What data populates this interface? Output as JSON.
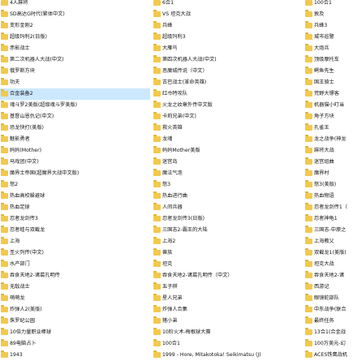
{
  "accent_color": "#f2c94c",
  "selected_color": "#cce8ff",
  "columns": [
    {
      "items": [
        {
          "label": "4人麻将"
        },
        {
          "label": "SD高达G时代(繁体中文)"
        },
        {
          "label": "变形金刚2"
        },
        {
          "label": "超级玛利2(日版)"
        },
        {
          "label": "赤影战士"
        },
        {
          "label": "第二次机器人大战(中文)"
        },
        {
          "label": "俄罗斯方块"
        },
        {
          "label": "功夫"
        },
        {
          "label": "合金装备2",
          "selected": true
        },
        {
          "label": "魂斗罗2美版(超级魂斗罗美版)"
        },
        {
          "label": "基督山恩仇记(中文)"
        },
        {
          "label": "恐龙快打(美版)"
        },
        {
          "label": "魅影勇者"
        },
        {
          "label": "妈妈(Mother)"
        },
        {
          "label": "马戏团(中文)"
        },
        {
          "label": "魔界士帝国(超魔界大战中文版)"
        },
        {
          "label": "怒2"
        },
        {
          "label": "热血高校躲避球"
        },
        {
          "label": "热血足球"
        },
        {
          "label": "忍者龙剑传3"
        },
        {
          "label": "忍者蛙与双截龙"
        },
        {
          "label": "上海"
        },
        {
          "label": "圣火列传(中文)"
        },
        {
          "label": "水产部门"
        },
        {
          "label": "吞食天地2-诸葛孔明传"
        },
        {
          "label": "无敌战士"
        },
        {
          "label": "萌萌龙"
        },
        {
          "label": "炸弹人2(美版)"
        },
        {
          "label": "侏罗纪公园"
        },
        {
          "label": "10倍力量职业棒球"
        },
        {
          "label": "89电脑占卜"
        },
        {
          "label": "1943"
        }
      ]
    },
    {
      "items": [
        {
          "label": "6合1"
        },
        {
          "label": "VS 坦克大战"
        },
        {
          "label": "兵蜂"
        },
        {
          "label": "超级玛利3"
        },
        {
          "label": "大雁鸟"
        },
        {
          "label": "第四次机器人大战(中文)"
        },
        {
          "label": "恶魔城传说（中文）"
        },
        {
          "label": "古巴战士(革命英雄)"
        },
        {
          "label": "红巾特攻队"
        },
        {
          "label": "火龙之纹章外传中文版"
        },
        {
          "label": "卡莉兄弟(中文)"
        },
        {
          "label": "救火英雄"
        },
        {
          "label": "龙魂"
        },
        {
          "label": "妈妈Mother美版"
        },
        {
          "label": "迷宫岛"
        },
        {
          "label": "魔法气泡"
        },
        {
          "label": "怒3"
        },
        {
          "label": "热血进行曲"
        },
        {
          "label": "人间兵器"
        },
        {
          "label": "忍者龙剑传3(日版)"
        },
        {
          "label": "三国志2-霸王的大陆"
        },
        {
          "label": "上海2"
        },
        {
          "label": "兽族"
        },
        {
          "label": "坦克"
        },
        {
          "label": "吞食天地2-诸葛孔明传（中文）"
        },
        {
          "label": "五子棋"
        },
        {
          "label": "星人兄弟"
        },
        {
          "label": "炸弹人合集"
        },
        {
          "label": "猪小弟"
        },
        {
          "label": "10阶火术-梅根球大赛"
        },
        {
          "label": "100合1"
        },
        {
          "label": "1999 - Hore, Mitakotoka! Seikimatsu (J)"
        }
      ]
    },
    {
      "items": [
        {
          "label": "100合1"
        },
        {
          "label": "敦及"
        },
        {
          "label": "兵蜂3"
        },
        {
          "label": "城市巡警"
        },
        {
          "label": "大炮兵"
        },
        {
          "label": "顶级摩托车"
        },
        {
          "label": "鳄鱼先生"
        },
        {
          "label": "国王骑士"
        },
        {
          "label": "荒野大镖客"
        },
        {
          "label": "机器猫小叮当"
        },
        {
          "label": "角子方块"
        },
        {
          "label": "孔雀王"
        },
        {
          "label": "龙之战争(神龙"
        },
        {
          "label": "麻将大战"
        },
        {
          "label": "迷宫组曲"
        },
        {
          "label": "魔界村"
        },
        {
          "label": "怒3(美版)"
        },
        {
          "label": "热血物语"
        },
        {
          "label": "忍者龙剑传1（"
        },
        {
          "label": "忍者神龟1"
        },
        {
          "label": "三国志-中原之"
        },
        {
          "label": "上海教父"
        },
        {
          "label": "双截龙1(美版)"
        },
        {
          "label": "坦克大战"
        },
        {
          "label": "吞食天地2-诸"
        },
        {
          "label": "西游记"
        },
        {
          "label": "眼镜蛇部队"
        },
        {
          "label": "中东战争(联合"
        },
        {
          "label": "最终任务"
        },
        {
          "label": "13合1(合金战"
        },
        {
          "label": "100万美元-幻"
        },
        {
          "label": "ACES铁鹰战机"
        }
      ]
    }
  ]
}
